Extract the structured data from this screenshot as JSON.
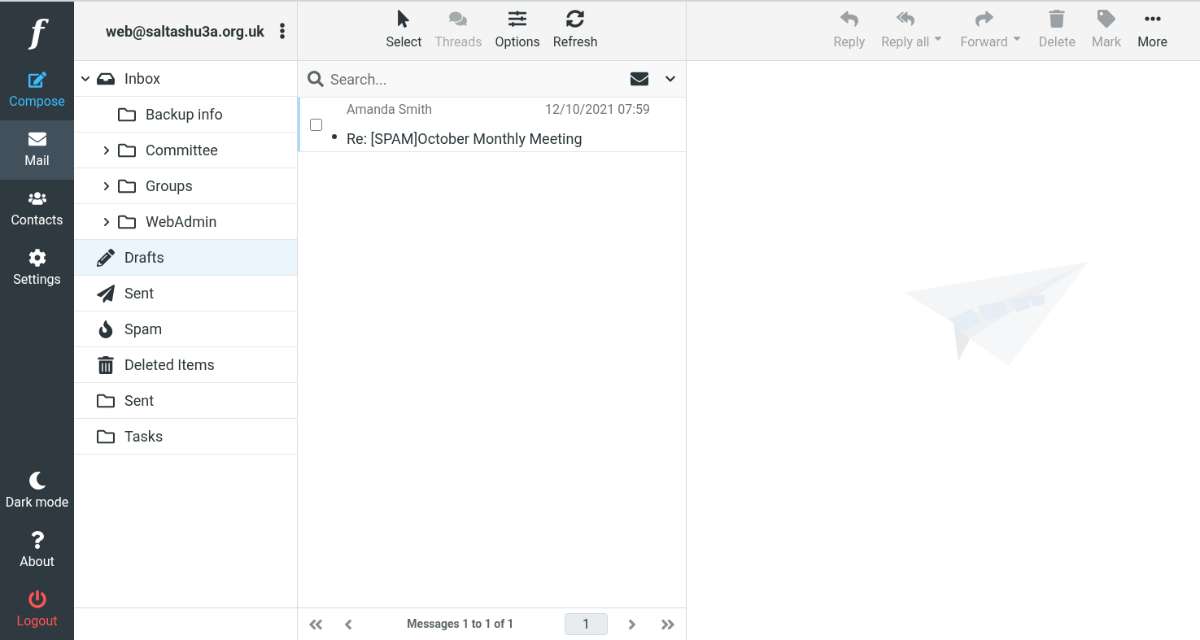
{
  "nav": {
    "logo": "f",
    "items": [
      {
        "label": "Compose",
        "kind": "compose",
        "selected": false
      },
      {
        "label": "Mail",
        "kind": "mail",
        "selected": true
      },
      {
        "label": "Contacts",
        "kind": "contacts",
        "selected": false
      },
      {
        "label": "Settings",
        "kind": "settings",
        "selected": false
      }
    ],
    "bottom_items": [
      {
        "label": "Dark mode",
        "kind": "darkmode"
      },
      {
        "label": "About",
        "kind": "about"
      },
      {
        "label": "Logout",
        "kind": "logout"
      }
    ]
  },
  "account": {
    "email": "web@saltashu3a.org.uk"
  },
  "folders": [
    {
      "label": "Inbox",
      "kind": "inbox",
      "selected": false,
      "expanded": true,
      "children": [
        {
          "label": "Backup info",
          "kind": "folder",
          "selected": false
        },
        {
          "label": "Committee",
          "kind": "folder",
          "selected": false,
          "expanded": false
        },
        {
          "label": "Groups",
          "kind": "folder",
          "selected": false,
          "expanded": false
        },
        {
          "label": "WebAdmin",
          "kind": "folder",
          "selected": false,
          "expanded": false
        }
      ]
    },
    {
      "label": "Drafts",
      "kind": "drafts",
      "selected": true
    },
    {
      "label": "Sent",
      "kind": "sent",
      "selected": false
    },
    {
      "label": "Spam",
      "kind": "spam",
      "selected": false
    },
    {
      "label": "Deleted Items",
      "kind": "trash",
      "selected": false
    },
    {
      "label": "Sent",
      "kind": "folder",
      "selected": false
    },
    {
      "label": "Tasks",
      "kind": "folder",
      "selected": false
    }
  ],
  "list_toolbar": [
    {
      "label": "Select",
      "kind": "select",
      "disabled": false
    },
    {
      "label": "Threads",
      "kind": "threads",
      "disabled": true
    },
    {
      "label": "Options",
      "kind": "options",
      "disabled": false
    },
    {
      "label": "Refresh",
      "kind": "refresh",
      "disabled": false
    }
  ],
  "search": {
    "placeholder": "Search..."
  },
  "messages": [
    {
      "from": "Amanda Smith",
      "date": "12/10/2021 07:59",
      "subject": "Re: [SPAM]October Monthly Meeting",
      "checked": false,
      "unread": true,
      "selected": true
    }
  ],
  "pagination": {
    "summary": "Messages 1 to 1 of 1",
    "page": "1"
  },
  "message_toolbar": [
    {
      "label": "Reply",
      "kind": "reply",
      "disabled": true,
      "dropdown": false
    },
    {
      "label": "Reply all",
      "kind": "replyall",
      "disabled": true,
      "dropdown": true
    },
    {
      "label": "Forward",
      "kind": "forward",
      "disabled": true,
      "dropdown": true
    },
    {
      "label": "Delete",
      "kind": "delete",
      "disabled": true,
      "dropdown": false
    },
    {
      "label": "Mark",
      "kind": "mark",
      "disabled": true,
      "dropdown": false
    },
    {
      "label": "More",
      "kind": "more",
      "disabled": false,
      "dropdown": false
    }
  ]
}
